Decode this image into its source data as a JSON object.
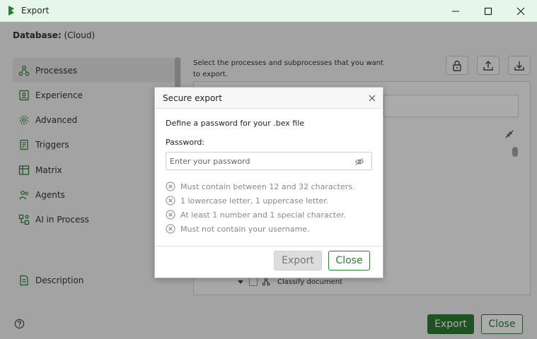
{
  "window": {
    "title": "Export",
    "logo_icon": "app-logo-icon",
    "minimize_icon": "minimize-icon",
    "maximize_icon": "maximize-icon",
    "close_icon": "close-icon"
  },
  "database": {
    "label": "Database:",
    "value": "(Cloud)"
  },
  "sidebar": {
    "items": [
      {
        "label": "Processes",
        "icon": "processes-icon",
        "active": true
      },
      {
        "label": "Experience",
        "icon": "experience-icon"
      },
      {
        "label": "Advanced",
        "icon": "gear-icon"
      },
      {
        "label": "Triggers",
        "icon": "triggers-icon"
      },
      {
        "label": "Matrix",
        "icon": "matrix-icon"
      },
      {
        "label": "Agents",
        "icon": "agents-icon"
      },
      {
        "label": "AI in Process",
        "icon": "ai-process-icon"
      }
    ],
    "description_label": "Description"
  },
  "main": {
    "hint": "Select the processes and subprocesses that you want to export.",
    "tree_item_label": "Classify document"
  },
  "footer": {
    "export_label": "Export",
    "close_label": "Close"
  },
  "modal": {
    "title": "Secure export",
    "description": "Define a password for your .bex file",
    "password_label": "Password:",
    "password_placeholder": "Enter your password",
    "password_value": "",
    "rules": [
      "Must contain between 12 and 32 characters.",
      "1 lowercase letter, 1 uppercase letter.",
      "At least 1 number and 1 special character.",
      "Must not contain your username."
    ],
    "export_label": "Export",
    "close_label": "Close"
  },
  "colors": {
    "brand_green": "#2e7d32",
    "titlebar_bg": "#e7f6ea",
    "disabled_button": "#dddddd"
  }
}
